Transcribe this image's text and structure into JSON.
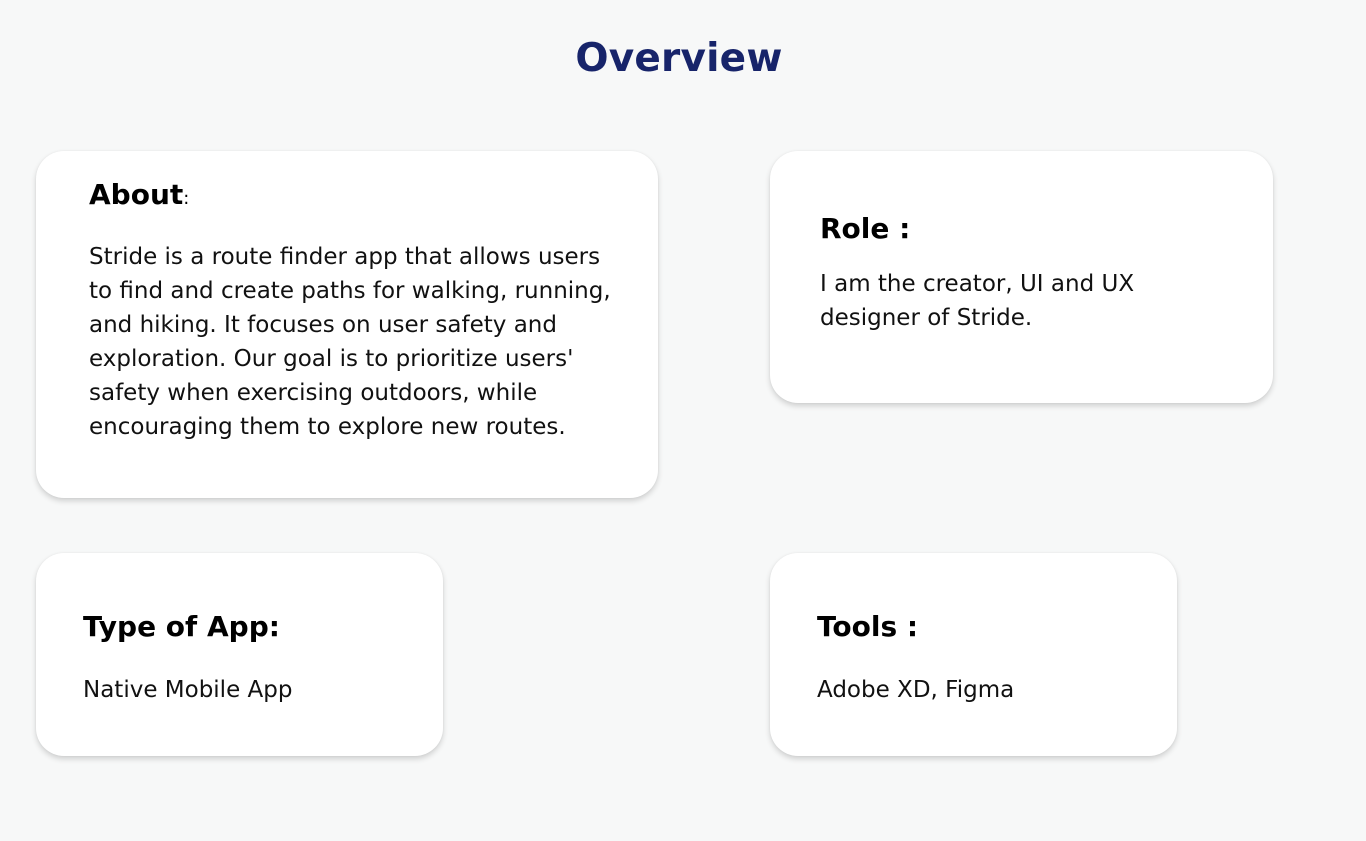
{
  "page": {
    "title": "Overview",
    "title_color": "#17246a",
    "background": "#f7f8f8"
  },
  "cards": {
    "about": {
      "heading": "About",
      "heading_suffix": ":",
      "body": "Stride is a route finder app that allows users to find and create paths for walking, running, and hiking. It focuses on user safety and exploration. Our goal is to prioritize users' safety when exercising outdoors, while encouraging them to explore new routes."
    },
    "role": {
      "heading": "Role :",
      "body": "I am the creator, UI and UX designer of Stride."
    },
    "type_of_app": {
      "heading": "Type of App:",
      "body": "Native Mobile App"
    },
    "tools": {
      "heading": "Tools :",
      "body": "Adobe XD, Figma"
    }
  }
}
